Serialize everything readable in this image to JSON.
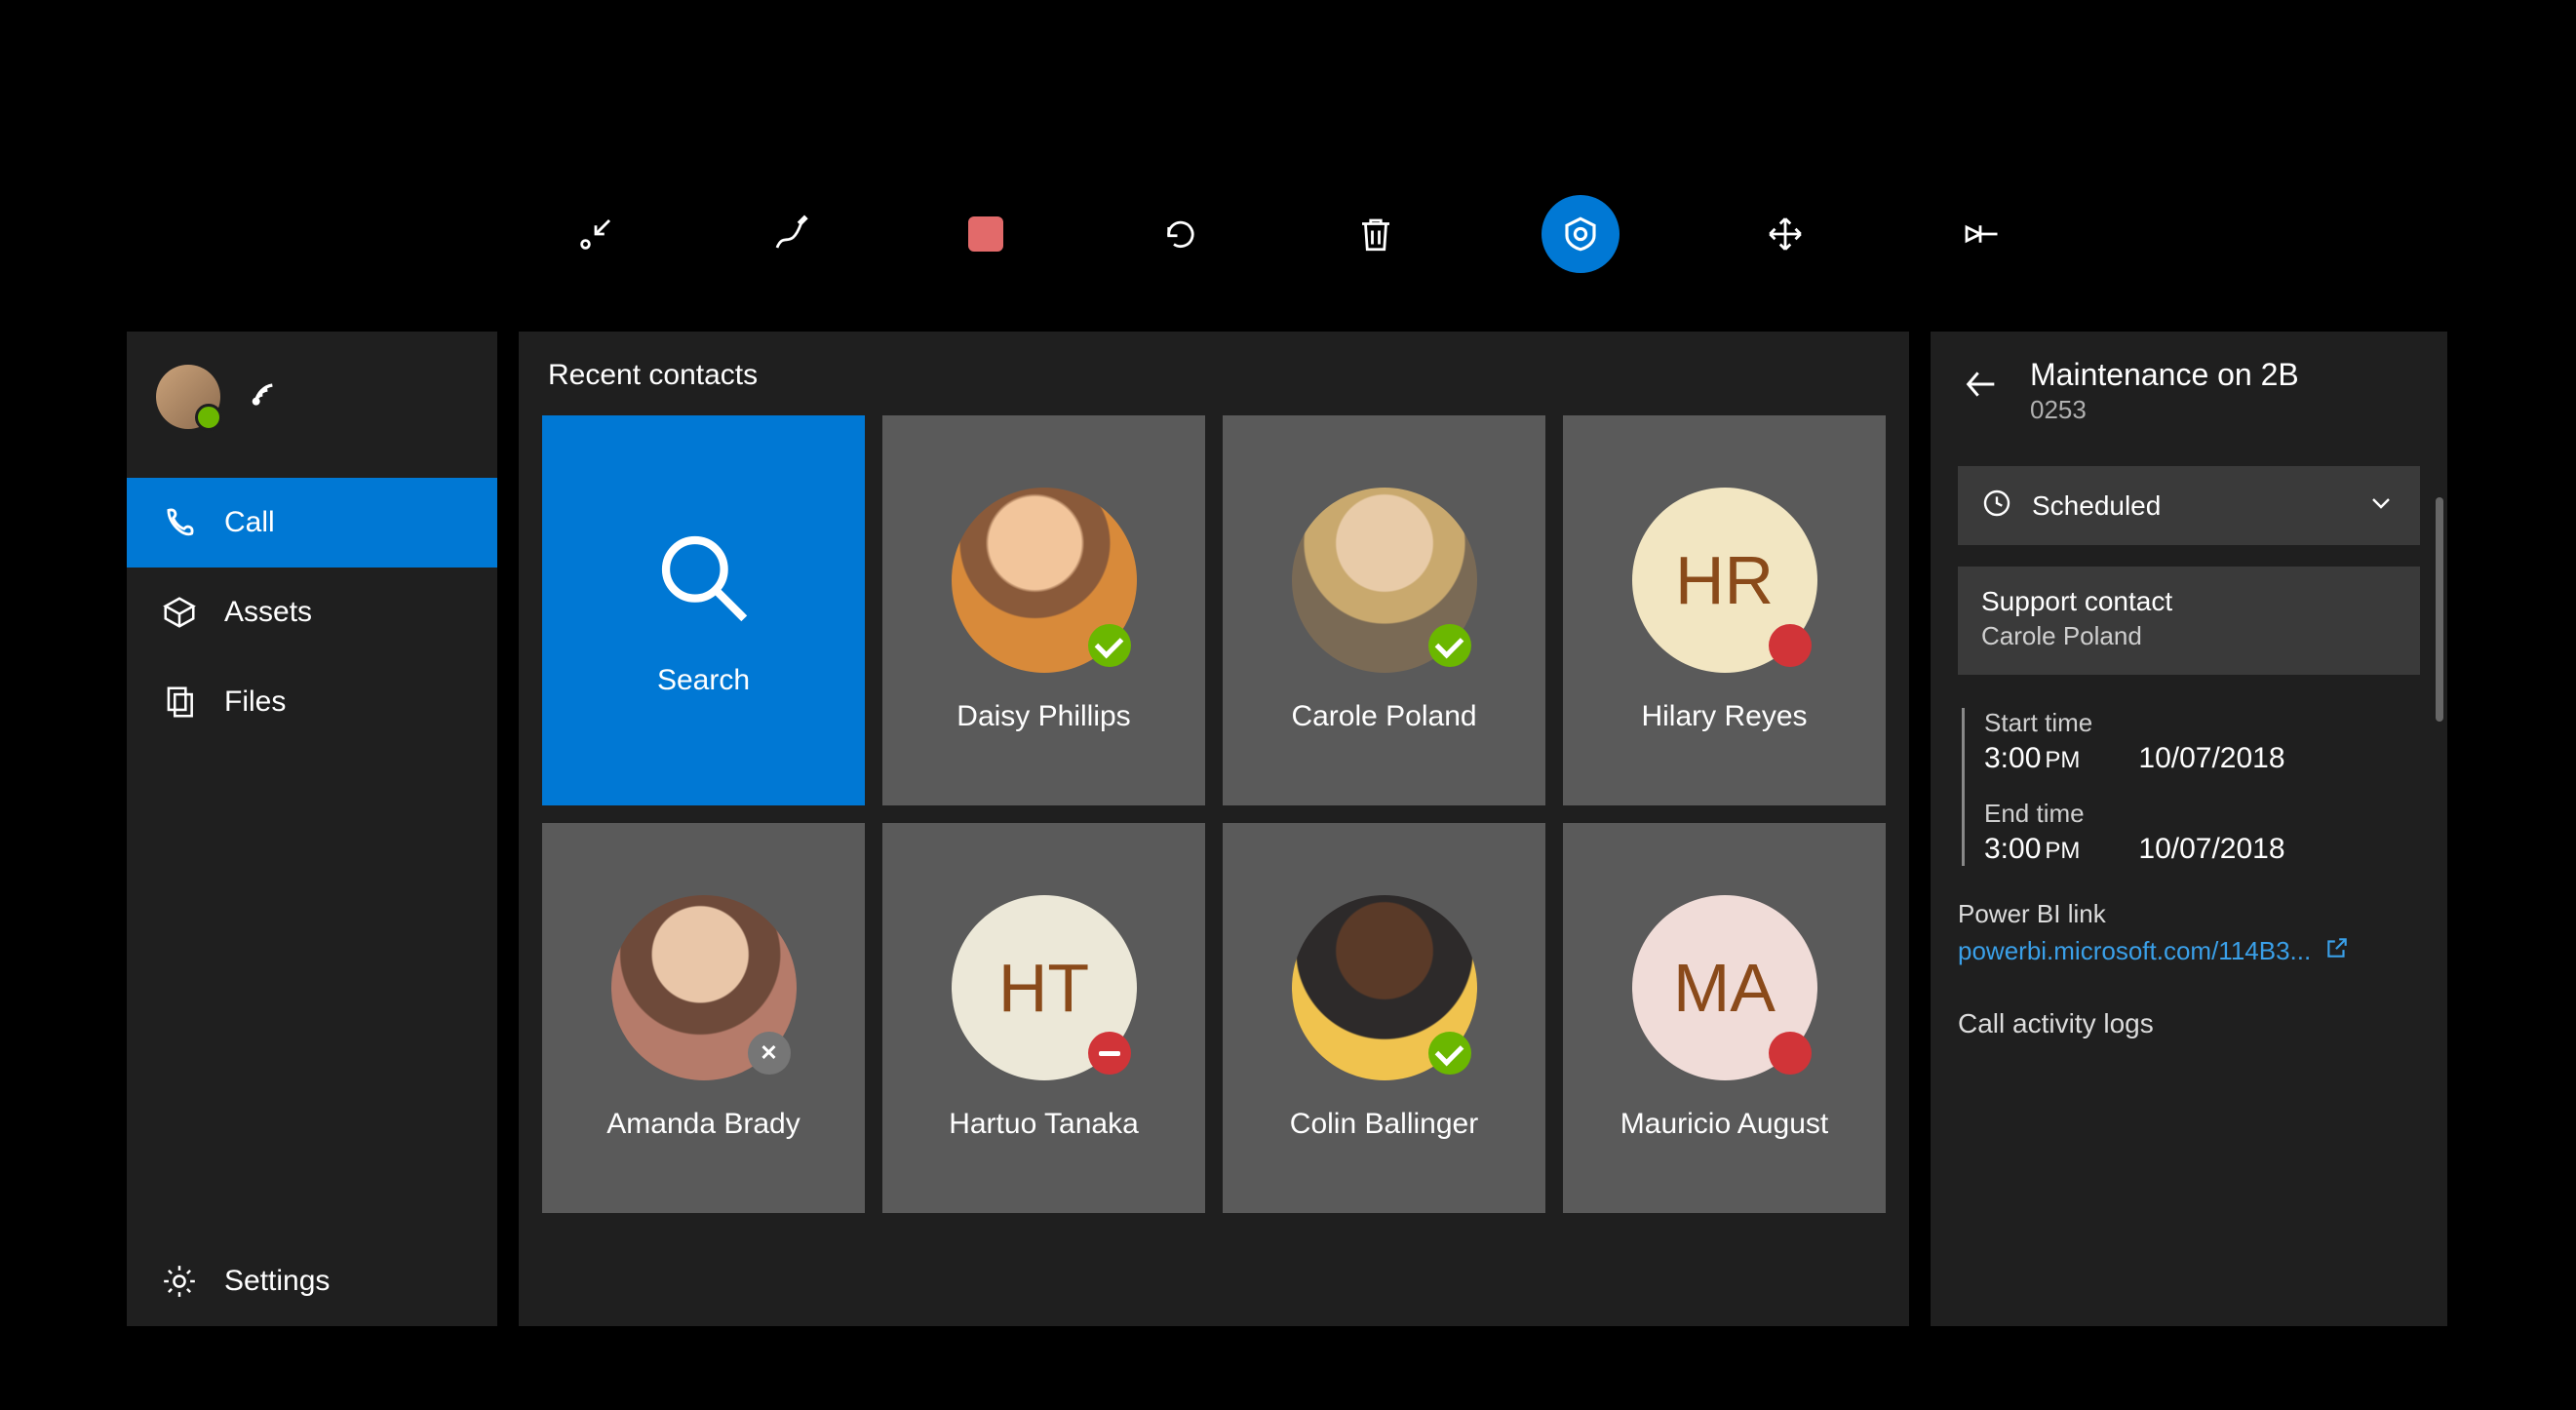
{
  "toolbar": {
    "items": [
      "minimize",
      "ink",
      "stop-record",
      "undo",
      "delete",
      "assist",
      "move",
      "pin"
    ]
  },
  "sidebar": {
    "items": [
      {
        "id": "call",
        "label": "Call",
        "active": true
      },
      {
        "id": "assets",
        "label": "Assets",
        "active": false
      },
      {
        "id": "files",
        "label": "Files",
        "active": false
      }
    ],
    "settings_label": "Settings"
  },
  "main": {
    "heading": "Recent contacts",
    "search_label": "Search",
    "contacts": [
      {
        "name": "Daisy Phillips",
        "type": "photo",
        "photo": "photo1",
        "status": "available"
      },
      {
        "name": "Carole Poland",
        "type": "photo",
        "photo": "photo2",
        "status": "available"
      },
      {
        "name": "Hilary Reyes",
        "type": "initials",
        "initials": "HR",
        "bg": "bg-cream",
        "status": "busy"
      },
      {
        "name": "Amanda Brady",
        "type": "photo",
        "photo": "photo3",
        "status": "offline"
      },
      {
        "name": "Hartuo Tanaka",
        "type": "initials",
        "initials": "HT",
        "bg": "bg-pale",
        "status": "dnd"
      },
      {
        "name": "Colin Ballinger",
        "type": "photo",
        "photo": "photo4",
        "status": "available"
      },
      {
        "name": "Mauricio August",
        "type": "initials",
        "initials": "MA",
        "bg": "bg-pink",
        "status": "busy"
      }
    ]
  },
  "detail": {
    "title": "Maintenance on 2B",
    "id": "0253",
    "status_label": "Scheduled",
    "support_contact_label": "Support contact",
    "support_contact_name": "Carole Poland",
    "start_label": "Start time",
    "start_time": "3:00",
    "start_ampm": "PM",
    "start_date": "10/07/2018",
    "end_label": "End time",
    "end_time": "3:00",
    "end_ampm": "PM",
    "end_date": "10/07/2018",
    "link_label": "Power BI link",
    "link_text": "powerbi.microsoft.com/114B3...",
    "activity_label": "Call activity logs"
  }
}
